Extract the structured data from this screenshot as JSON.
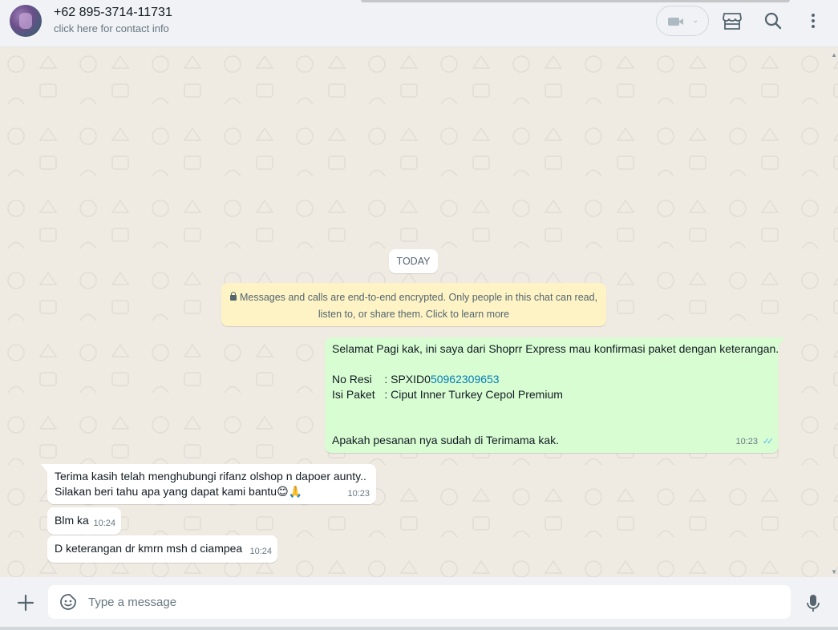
{
  "header": {
    "contact_name": "+62 895-3714-11731",
    "contact_subtitle": "click here for contact info",
    "icons": [
      "video-call-icon",
      "chevron-down-icon",
      "shop-icon",
      "search-icon",
      "menu-icon"
    ]
  },
  "chat": {
    "date_label": "TODAY",
    "encryption_notice": "Messages and calls are end-to-end encrypted. Only people in this chat can read, listen to, or share them. Click to learn more",
    "messages": [
      {
        "direction": "outgoing",
        "line1": "Selamat Pagi kak, ini saya dari Shoprr Express mau konfirmasi paket dengan keterangan.",
        "resi_label": "No Resi    : SPXID0",
        "resi_link": "50962309653",
        "paket_line": "Isi Paket   : Ciput Inner Turkey Cepol Premium",
        "last_line": "Apakah pesanan nya sudah di Terimama kak.",
        "time": "10:23",
        "status": "read"
      },
      {
        "direction": "incoming",
        "line1": "Terima kasih telah menghubungi rifanz olshop n dapoer aunty..",
        "line2": "Silakan beri tahu apa yang dapat kami bantu😊🙏",
        "time": "10:23"
      },
      {
        "direction": "incoming",
        "text": "Blm ka",
        "time": "10:24"
      },
      {
        "direction": "incoming",
        "text": "D keterangan dr kmrn msh d ciampea",
        "time": "10:24"
      }
    ]
  },
  "footer": {
    "placeholder": "Type a message",
    "value": ""
  },
  "colors": {
    "outgoing_bubble": "#d9fdd3",
    "incoming_bubble": "#ffffff",
    "chat_background": "#efeae2",
    "notice_background": "#fdf3c5",
    "read_ticks": "#53bdeb"
  }
}
